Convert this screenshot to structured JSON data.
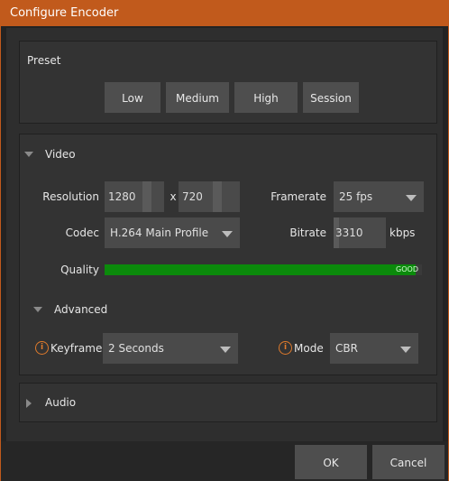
{
  "window": {
    "title": "Configure Encoder"
  },
  "preset": {
    "title": "Preset",
    "buttons": [
      "Low",
      "Medium",
      "High",
      "Session"
    ]
  },
  "video": {
    "title": "Video",
    "resolution_label": "Resolution",
    "width": "1280",
    "separator": "x",
    "height": "720",
    "framerate_label": "Framerate",
    "framerate_value": "25 fps",
    "codec_label": "Codec",
    "codec_value": "H.264 Main Profile",
    "bitrate_label": "Bitrate",
    "bitrate_value": "3310",
    "bitrate_unit": "kbps",
    "quality_label": "Quality",
    "quality_text": "GOOD",
    "quality_level": 0.98,
    "quality_color": "#0b8a0b"
  },
  "advanced": {
    "title": "Advanced",
    "keyframe_label": "Keyframe",
    "keyframe_value": "2 Seconds",
    "mode_label": "Mode",
    "mode_value": "CBR",
    "info_icon": "info-icon",
    "info_color": "#e07b2c"
  },
  "audio": {
    "title": "Audio"
  },
  "footer": {
    "ok_label": "OK",
    "cancel_label": "Cancel"
  },
  "colors": {
    "titlebar": "#c15a1c",
    "button": "#4e4e4e"
  }
}
